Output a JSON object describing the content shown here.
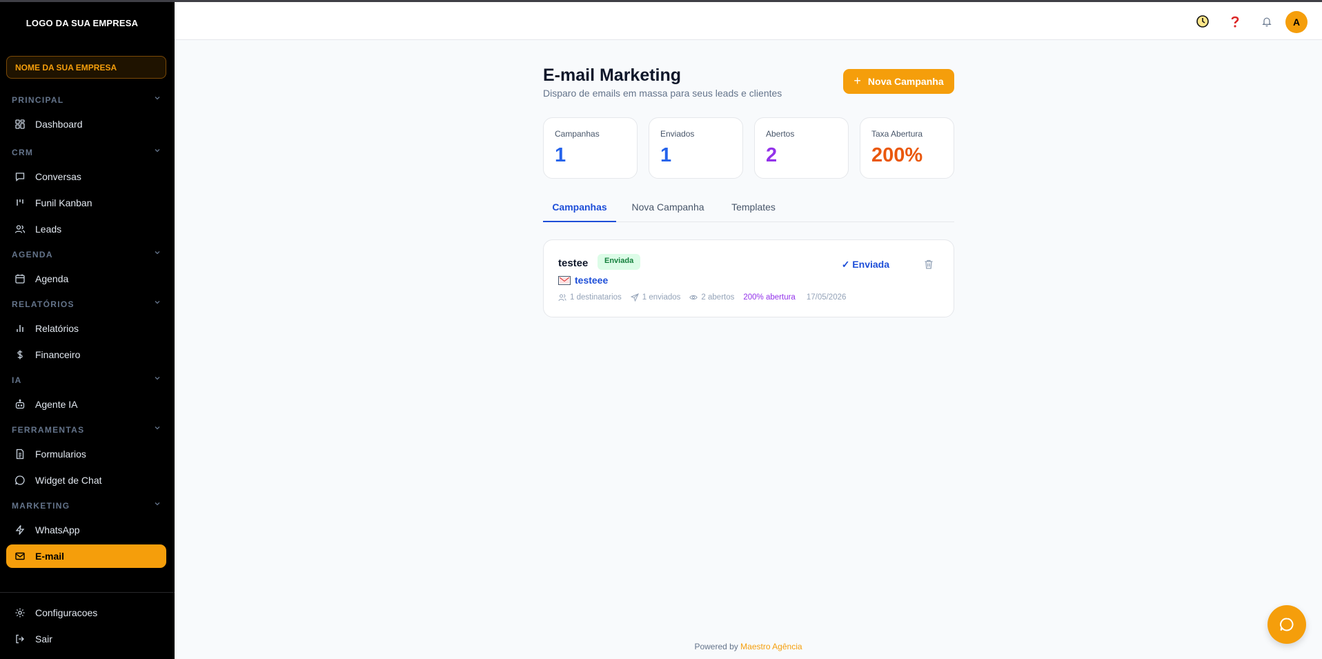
{
  "sidebar": {
    "logo": "LOGO DA SUA EMPRESA",
    "company": "NOME DA SUA EMPRESA",
    "sections": {
      "principal": "PRINCIPAL",
      "crm": "CRM",
      "agenda": "AGENDA",
      "relatorios": "RELATÓRIOS",
      "ia": "IA",
      "ferramentas": "FERRAMENTAS",
      "marketing": "MARKETING"
    },
    "items": {
      "dashboard": "Dashboard",
      "conversas": "Conversas",
      "funil": "Funil Kanban",
      "leads": "Leads",
      "agenda": "Agenda",
      "relatorios": "Relatórios",
      "financeiro": "Financeiro",
      "agente": "Agente IA",
      "formularios": "Formularios",
      "widget": "Widget de Chat",
      "whatsapp": "WhatsApp",
      "email": "E-mail",
      "configuracoes": "Configuracoes",
      "sair": "Sair"
    },
    "active_item": "E-mail"
  },
  "header": {
    "avatar_initial": "A",
    "icons": [
      "clock-icon",
      "help-icon",
      "bell-icon"
    ]
  },
  "main": {
    "title": "E-mail Marketing",
    "subtitle": "Disparo de emails em massa para seus leads e clientes",
    "new_button": "Nova Campanha",
    "stats": [
      {
        "label": "Campanhas",
        "value": "1",
        "color": "#2563eb"
      },
      {
        "label": "Enviados",
        "value": "1",
        "color": "#2563eb"
      },
      {
        "label": "Abertos",
        "value": "2",
        "color": "#9333ea"
      },
      {
        "label": "Taxa Abertura",
        "value": "200%",
        "color": "#ea580c"
      }
    ],
    "tabs": [
      "Campanhas",
      "Nova Campanha",
      "Templates"
    ],
    "active_tab": "Campanhas",
    "campaign": {
      "name": "testee",
      "badge": "Enviada",
      "subject": "testeee",
      "recipients": "1 destinatarios",
      "sent": "1 enviados",
      "opened": "2 abertos",
      "open_rate": "200% abertura",
      "date": "17/05/2026",
      "status_link": "✓ Enviada"
    }
  },
  "footer": {
    "prefix": "Powered by",
    "brand": "Maestro Agência"
  },
  "colors": {
    "accent": "#f59e0b",
    "sidebar_bg": "#000000",
    "link": "#1d4ed8"
  }
}
